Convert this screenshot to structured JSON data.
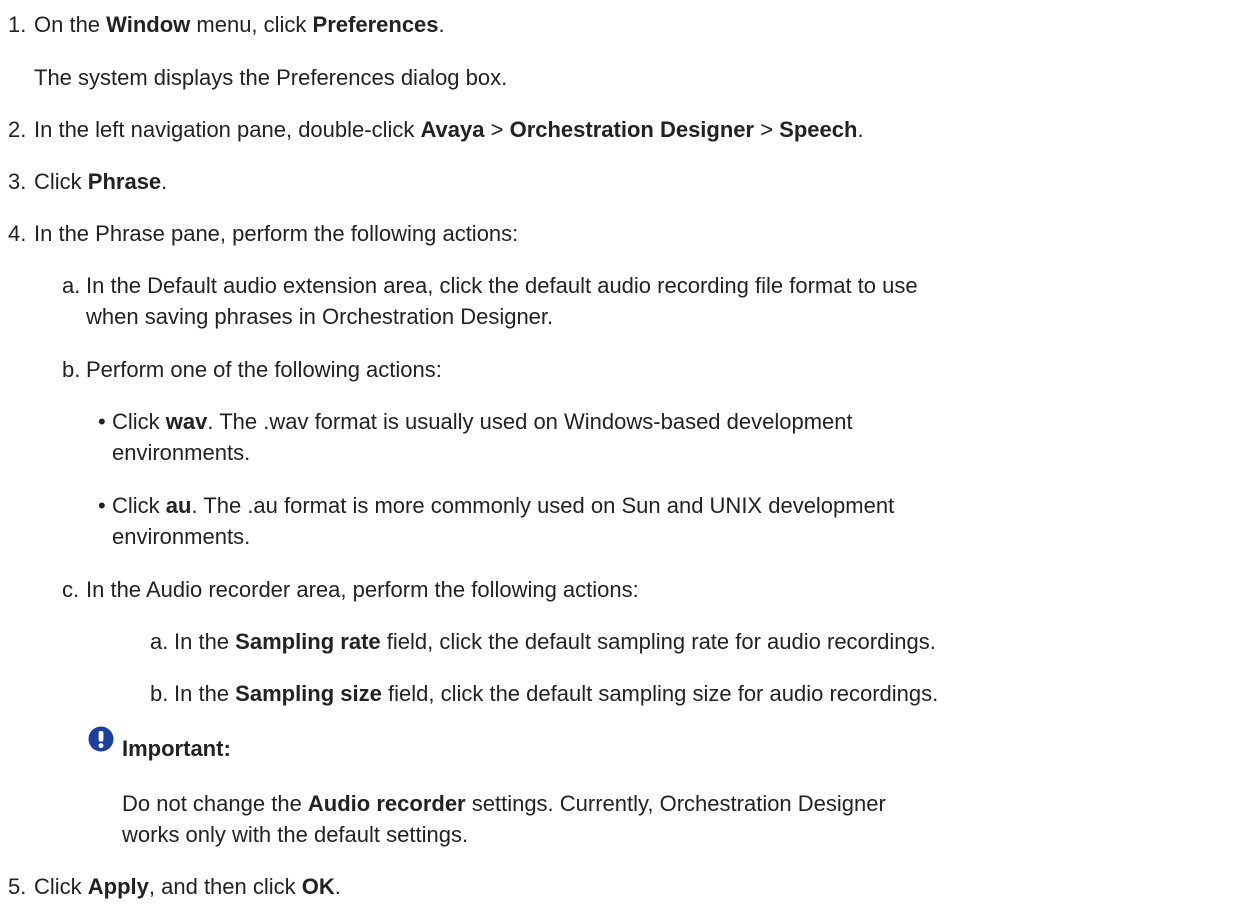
{
  "steps": [
    {
      "number": "1.",
      "text": {
        "pre": "On the ",
        "b1": "Window",
        "mid": " menu, click ",
        "b2": "Preferences",
        "post": "."
      },
      "result": "The system displays the Preferences dialog box."
    },
    {
      "number": "2.",
      "text": {
        "pre": "In the left navigation pane, double-click ",
        "b1": "Avaya",
        "sep1": " > ",
        "b2": "Orchestration Designer",
        "sep2": " > ",
        "b3": "Speech",
        "post": "."
      }
    },
    {
      "number": "3.",
      "text": {
        "pre": "Click ",
        "b1": "Phrase",
        "post": "."
      }
    },
    {
      "number": "4.",
      "text": "In the Phrase pane, perform the following actions:",
      "substeps": [
        {
          "letter": "a.",
          "line1": "In the Default audio extension area, click the default audio recording file format to use",
          "line2": "when saving phrases in Orchestration Designer."
        },
        {
          "letter": "b.",
          "text": "Perform one of the following actions:",
          "bullets": [
            {
              "pre": "Click ",
              "b": "wav",
              "post": ". The .wav format is usually used on Windows-based development",
              "line2": "environments."
            },
            {
              "pre": "Click ",
              "b": "au",
              "post": ". The .au format is more commonly used on Sun and UNIX development",
              "line2": "environments."
            }
          ]
        },
        {
          "letter": "c.",
          "text": "In the Audio recorder area, perform the following actions:",
          "substeps": [
            {
              "letter": "a.",
              "pre": "In the ",
              "b": "Sampling rate",
              "post": " field, click the default sampling rate for audio recordings."
            },
            {
              "letter": "b.",
              "pre": "In the ",
              "b": "Sampling size",
              "post": " field, click the default sampling size for audio recordings."
            }
          ],
          "note": {
            "icon": "important-icon",
            "title": "Important:",
            "pre": "Do not change the ",
            "b": "Audio recorder",
            "post": " settings. Currently, Orchestration Designer",
            "line2": "works only with the default settings."
          }
        }
      ]
    },
    {
      "number": "5.",
      "text": {
        "pre": "Click ",
        "b1": "Apply",
        "mid": ", and then click ",
        "b2": "OK",
        "post": "."
      }
    }
  ],
  "colors": {
    "text": "#222222",
    "icon": "#1b3f9e",
    "background": "#ffffff"
  }
}
